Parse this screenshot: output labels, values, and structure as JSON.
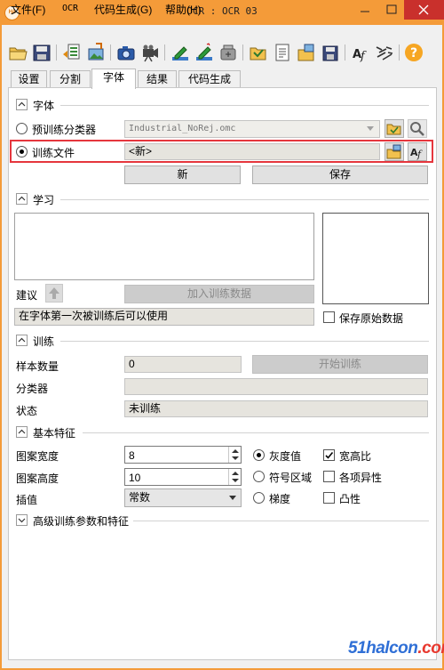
{
  "window": {
    "title": "OCR : OCR 03",
    "app_icon_text": "HA"
  },
  "menu": [
    {
      "label": "文件(F)"
    },
    {
      "label": "OCR"
    },
    {
      "label": "代码生成(G)"
    },
    {
      "label": "帮助(H)"
    }
  ],
  "toolbar_icons": [
    "open-folder-icon",
    "save-disk-icon",
    "load-data-icon",
    "image-export-icon",
    "camera-icon",
    "video-camera-icon",
    "pencil-edit-icon",
    "pencil-draw-icon",
    "container-icon",
    "open-file-icon",
    "document-icon",
    "image-import-icon",
    "image-save-icon",
    "font-af-icon",
    "texture-icon",
    "help-icon"
  ],
  "tabs": [
    {
      "label": "设置",
      "active": false
    },
    {
      "label": "分割",
      "active": false
    },
    {
      "label": "字体",
      "active": true
    },
    {
      "label": "结果",
      "active": false
    },
    {
      "label": "代码生成",
      "active": false
    }
  ],
  "font_section": {
    "title": "字体",
    "pretrained_label": "预训练分类器",
    "pretrained_value": "Industrial_NoRej.omc",
    "train_file_label": "训练文件",
    "train_file_value": "<新>",
    "new_button": "新",
    "save_button": "保存",
    "selected_radio": "train_file"
  },
  "learn_section": {
    "title": "学习",
    "suggest_label": "建议",
    "add_training_data_button": "加入训练数据",
    "hint": "在字体第一次被训练后可以使用",
    "keep_raw_label": "保存原始数据",
    "keep_raw_checked": false
  },
  "train_section": {
    "title": "训练",
    "sample_count_label": "样本数量",
    "sample_count_value": "0",
    "start_button": "开始训练",
    "classifier_label": "分类器",
    "classifier_value": "",
    "status_label": "状态",
    "status_value": "未训练"
  },
  "basic_features": {
    "title": "基本特征",
    "pattern_width_label": "图案宽度",
    "pattern_width_value": "8",
    "pattern_height_label": "图案高度",
    "pattern_height_value": "10",
    "interpolation_label": "插值",
    "interpolation_value": "常数",
    "radios": [
      {
        "label": "灰度值",
        "checked": true
      },
      {
        "label": "符号区域",
        "checked": false
      },
      {
        "label": "梯度",
        "checked": false
      }
    ],
    "checks": [
      {
        "label": "宽高比",
        "checked": true
      },
      {
        "label": "各项异性",
        "checked": false
      },
      {
        "label": "凸性",
        "checked": false
      }
    ]
  },
  "advanced_section": {
    "title": "高级训练参数和特征"
  },
  "watermark": {
    "main": "51halcon",
    "suffix": ".com"
  },
  "colors": {
    "frame": "#f49b39",
    "highlight": "#e5363d",
    "close": "#c9302c"
  }
}
